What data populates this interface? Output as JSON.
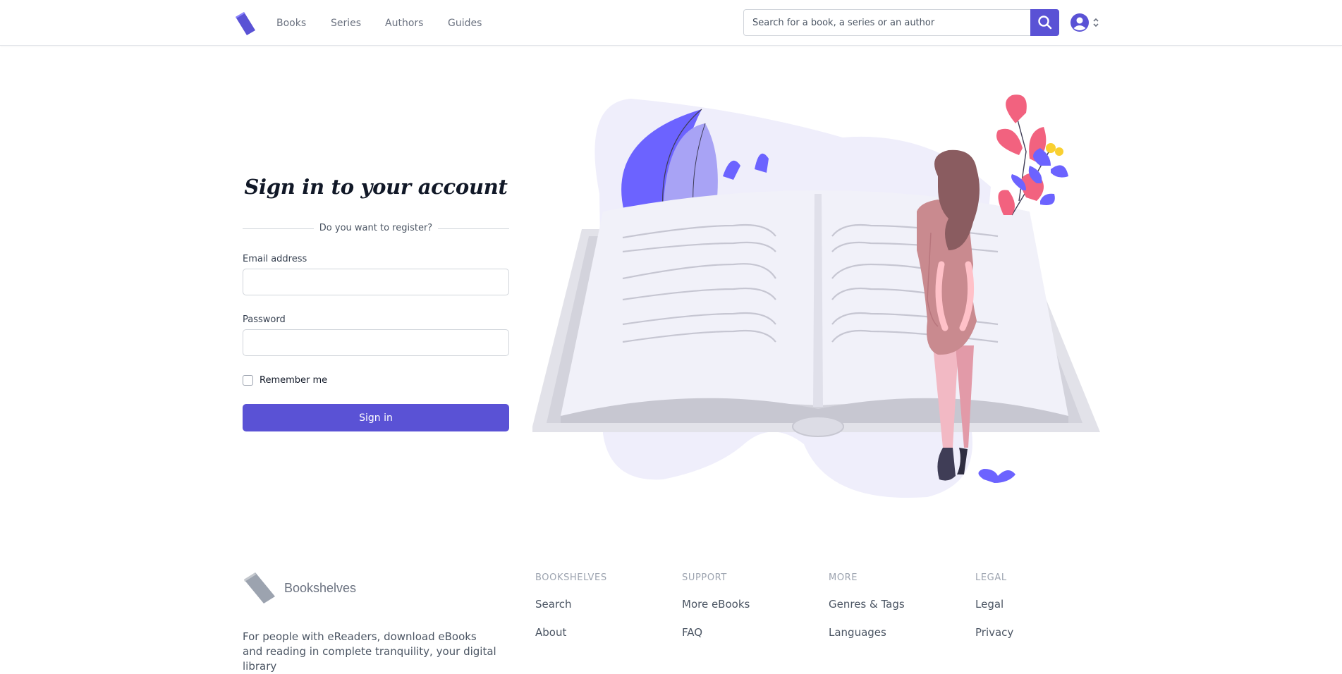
{
  "nav": {
    "logo_icon": "book-icon",
    "links": [
      "Books",
      "Series",
      "Authors",
      "Guides"
    ]
  },
  "search": {
    "placeholder": "Search for a book, a series or an author",
    "button_icon": "search-icon"
  },
  "user_menu": {
    "icon": "user-circle-icon",
    "caret_icon": "chevron-up-down-icon"
  },
  "signin": {
    "title": "Sign in to your account",
    "register_prompt": "Do you want to register?",
    "email_label": "Email address",
    "email_value": "",
    "password_label": "Password",
    "password_value": "",
    "remember_label": "Remember me",
    "remember_checked": false,
    "submit_label": "Sign in"
  },
  "illustration": {
    "name": "woman-reading-open-book-illustration"
  },
  "footer": {
    "brand": "Bookshelves",
    "tagline": "For people with eReaders, download eBooks and reading in complete tranquility, your digital library",
    "columns": [
      {
        "heading": "BOOKSHELVES",
        "links": [
          "Search",
          "About"
        ]
      },
      {
        "heading": "SUPPORT",
        "links": [
          "More eBooks",
          "FAQ"
        ]
      },
      {
        "heading": "MORE",
        "links": [
          "Genres & Tags",
          "Languages"
        ]
      },
      {
        "heading": "LEGAL",
        "links": [
          "Legal",
          "Privacy"
        ]
      }
    ]
  },
  "colors": {
    "accent": "#5a52d5",
    "text_dark": "#111827",
    "text_muted": "#6b7280",
    "border": "#d1d5db",
    "illustration_pink": "#f2627f",
    "illustration_purple": "#6c63ff"
  }
}
